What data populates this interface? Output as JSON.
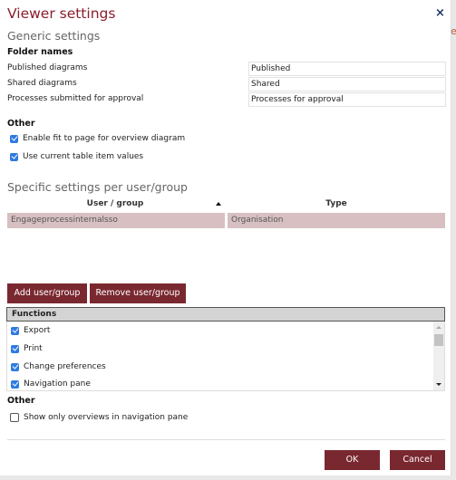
{
  "background_glyph": "e",
  "dialog": {
    "title": "Viewer settings",
    "close_icon": "×"
  },
  "generic": {
    "heading": "Generic settings",
    "folder_names": {
      "heading": "Folder names",
      "fields": [
        {
          "label": "Published diagrams",
          "value": "Published"
        },
        {
          "label": "Shared diagrams",
          "value": "Shared"
        },
        {
          "label": "Processes submitted for approval",
          "value": "Processes for approval"
        }
      ]
    },
    "other": {
      "heading": "Other",
      "options": [
        {
          "label": "Enable fit to page for overview diagram",
          "checked": true
        },
        {
          "label": "Use current table item values",
          "checked": true
        }
      ]
    }
  },
  "specific": {
    "heading": "Specific settings per user/group",
    "columns": [
      "User / group",
      "Type"
    ],
    "sort": "ascending",
    "rows": [
      {
        "user_group": "Engageprocessinternalsso",
        "type": "Organisation",
        "selected": true
      }
    ],
    "add_button": "Add user/group",
    "remove_button": "Remove user/group"
  },
  "functions": {
    "heading": "Functions",
    "items": [
      {
        "label": "Export",
        "checked": true
      },
      {
        "label": "Print",
        "checked": true
      },
      {
        "label": "Change preferences",
        "checked": true
      },
      {
        "label": "Navigation pane",
        "checked": true
      }
    ]
  },
  "other2": {
    "heading": "Other",
    "options": [
      {
        "label": "Show only overviews in navigation pane",
        "checked": false
      }
    ]
  },
  "footer": {
    "ok": "OK",
    "cancel": "Cancel"
  },
  "colors": {
    "title": "#8a1e2c",
    "button": "#7a2830",
    "selected_row": "#d7bfc2",
    "checkbox": "#2f7be0"
  }
}
